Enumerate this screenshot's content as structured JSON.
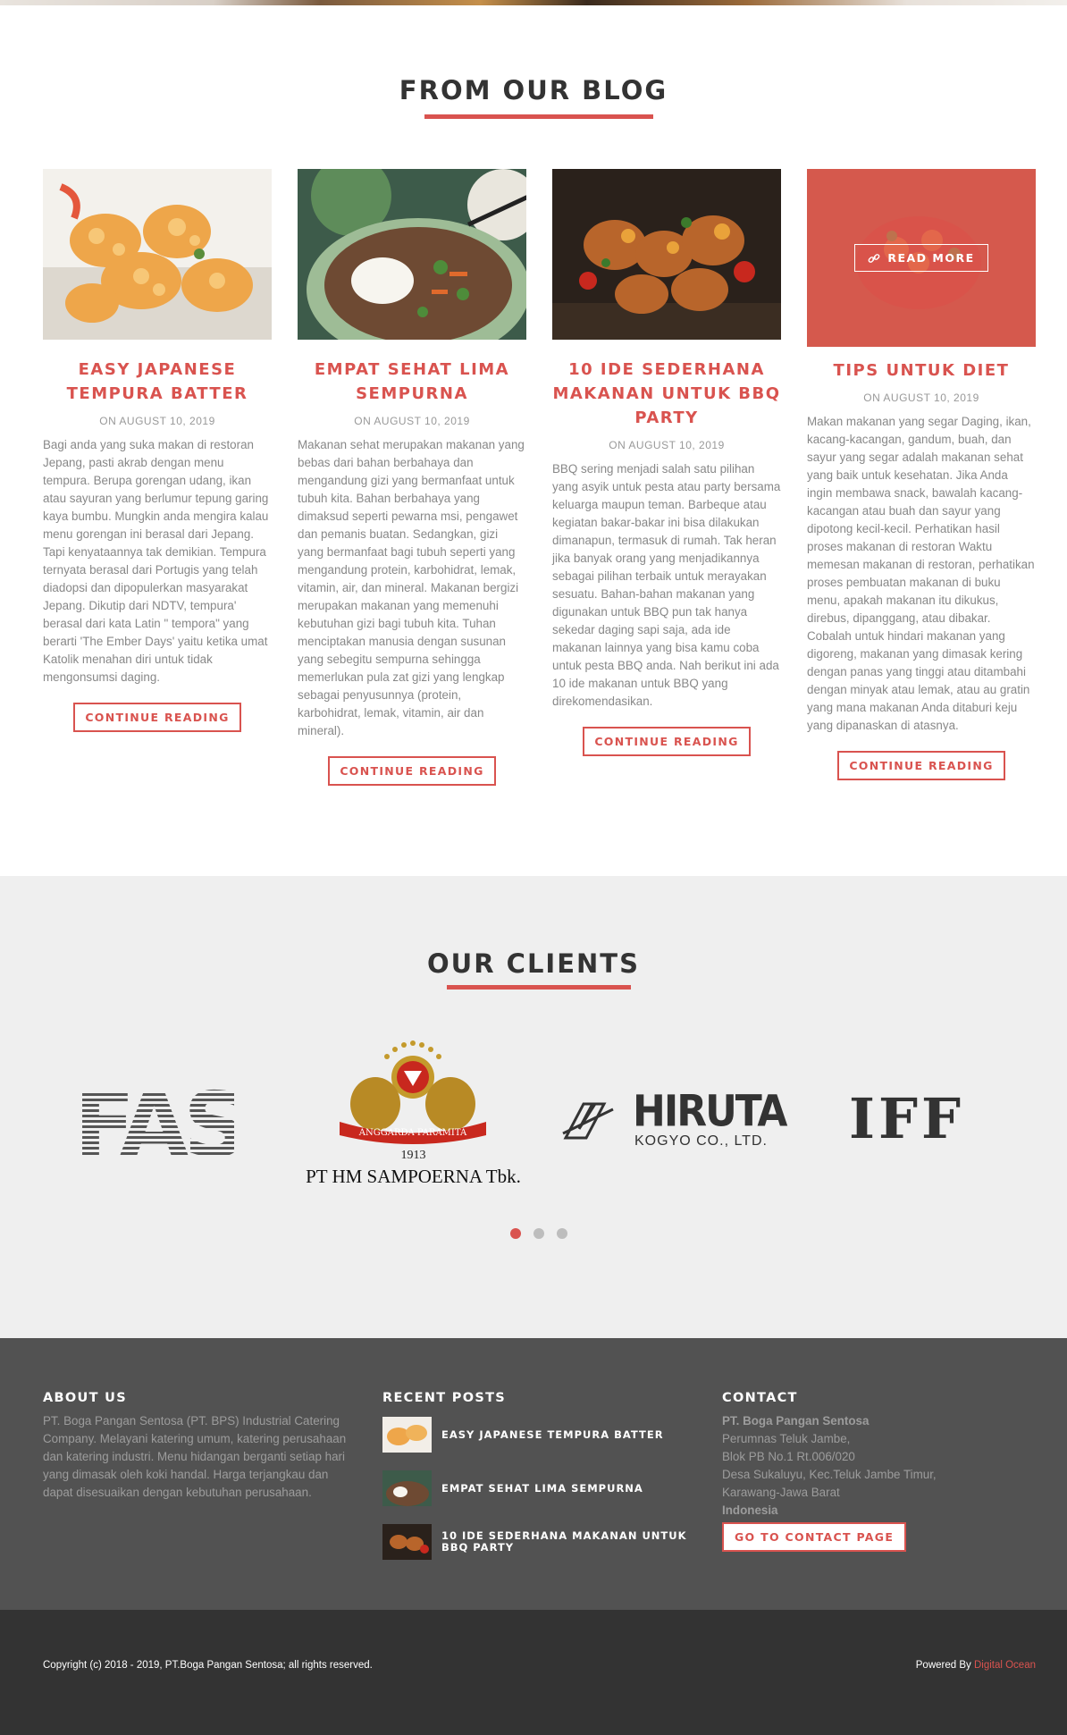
{
  "colors": {
    "accent": "#d9534f",
    "footer_bg": "#525252",
    "bottom_bg": "#333333",
    "clients_bg": "#efefef"
  },
  "blog": {
    "title": "FROM OUR BLOG",
    "posts": [
      {
        "title": "EASY JAPANESE TEMPURA BATTER",
        "date": "ON AUGUST 10, 2019",
        "excerpt": "Bagi anda yang suka makan di restoran Jepang, pasti akrab dengan menu tempura. Berupa gorengan udang, ikan atau sayuran yang berlumur tepung garing kaya bumbu. Mungkin anda mengira kalau menu gorengan ini berasal dari Jepang. Tapi kenyataannya tak demikian. Tempura ternyata berasal dari Portugis yang telah diadopsi dan dipopulerkan masyarakat Jepang. Dikutip dari NDTV, tempura' berasal dari kata Latin \" tempora\" yang berarti 'The Ember Days' yaitu ketika umat Katolik menahan diri untuk tidak mengonsumsi daging.",
        "button": "CONTINUE READING"
      },
      {
        "title": "EMPAT SEHAT LIMA SEMPURNA",
        "date": "ON AUGUST 10, 2019",
        "excerpt": "Makanan sehat merupakan makanan yang bebas dari bahan berbahaya dan mengandung gizi yang bermanfaat untuk tubuh kita. Bahan berbahaya yang dimaksud seperti pewarna msi, pengawet dan pemanis buatan. Sedangkan, gizi yang bermanfaat bagi tubuh seperti yang mengandung protein, karbohidrat, lemak, vitamin, air, dan mineral. Makanan bergizi merupakan makanan yang memenuhi kebutuhan gizi bagi tubuh kita. Tuhan menciptakan manusia dengan susunan yang sebegitu sempurna sehingga memerlukan pula zat gizi yang lengkap sebagai penyusunnya (protein, karbohidrat, lemak, vitamin, air dan mineral).",
        "button": "CONTINUE READING"
      },
      {
        "title": "10 IDE SEDERHANA MAKANAN UNTUK BBQ PARTY",
        "date": "ON AUGUST 10, 2019",
        "excerpt": "BBQ sering menjadi salah satu pilihan yang asyik untuk pesta atau party bersama keluarga maupun teman. Barbeque atau kegiatan bakar-bakar ini bisa dilakukan dimanapun, termasuk di rumah. Tak heran jika banyak orang yang menjadikannya sebagai pilihan terbaik untuk merayakan sesuatu. Bahan-bahan makanan yang digunakan untuk BBQ pun tak hanya sekedar daging sapi saja, ada ide makanan lainnya yang bisa kamu coba untuk pesta BBQ anda. Nah berikut ini ada 10 ide makanan untuk BBQ yang direkomendasikan.",
        "button": "CONTINUE READING"
      },
      {
        "title": "TIPS UNTUK DIET",
        "date": "ON AUGUST 10, 2019",
        "excerpt": "Makan makanan yang segar Daging, ikan, kacang-kacangan, gandum, buah, dan sayur yang segar adalah makanan sehat yang baik untuk kesehatan. Jika Anda ingin membawa snack, bawalah kacang-kacangan atau buah dan sayur yang dipotong kecil-kecil. Perhatikan hasil proses makanan di restoran Waktu memesan makanan di restoran, perhatikan proses pembuatan makanan di buku menu, apakah makanan itu dikukus, direbus, dipanggang, atau dibakar. Cobalah untuk hindari makanan yang digoreng, makanan yang dimasak kering dengan panas yang tinggi atau ditambahi dengan minyak atau lemak, atau au gratin yang mana makanan Anda ditaburi keju yang dipanaskan di atasnya.",
        "button": "CONTINUE READING",
        "overlay_label": "READ MORE"
      }
    ]
  },
  "clients": {
    "title": "OUR CLIENTS",
    "logos": [
      {
        "text": "FAS"
      },
      {
        "banner": "ANGGARDA PARAMITA",
        "year": "1913",
        "name": "PT HM SAMPOERNA Tbk."
      },
      {
        "text": "HIRUTA",
        "sub": "KOGYO CO., LTD."
      },
      {
        "text": "IFF"
      }
    ],
    "slide_count": 3,
    "active_slide": 1
  },
  "footer": {
    "about": {
      "heading": "ABOUT US",
      "text": "PT. Boga Pangan Sentosa (PT. BPS) Industrial Catering Company. Melayani katering umum, katering perusahaan dan katering industri. Menu hidangan berganti setiap hari yang dimasak oleh koki handal. Harga terjangkau dan dapat disesuaikan dengan kebutuhan perusahaan."
    },
    "recent": {
      "heading": "RECENT POSTS",
      "items": [
        "EASY JAPANESE TEMPURA BATTER",
        "EMPAT SEHAT LIMA SEMPURNA",
        "10 IDE SEDERHANA MAKANAN UNTUK BBQ PARTY"
      ]
    },
    "contact": {
      "heading": "CONTACT",
      "company": "PT. Boga Pangan Sentosa",
      "line1": "Perumnas Teluk Jambe,",
      "line2": "Blok PB No.1 Rt.006/020",
      "line3": "Desa Sukaluyu, Kec.Teluk Jambe Timur,",
      "line4": "Karawang-Jawa Barat",
      "country": "Indonesia",
      "button": "GO TO CONTACT PAGE"
    }
  },
  "bottom": {
    "copyright": "Copyright (c) 2018 - 2019, PT.Boga Pangan Sentosa; all rights reserved.",
    "powered_prefix": "Powered By ",
    "powered_link": "Digital Ocean"
  }
}
